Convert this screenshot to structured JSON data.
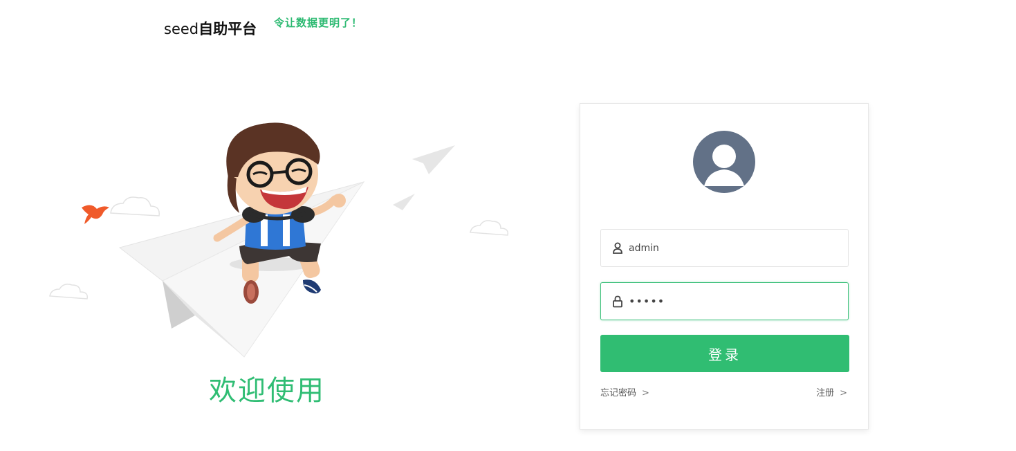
{
  "header": {
    "brand_prefix": "seed",
    "brand_suffix": "自助平台",
    "slogan": "令让数据更明了！"
  },
  "illustration": {
    "welcome_text": "欢迎使用"
  },
  "login": {
    "username_value": "admin",
    "password_value": "•••••",
    "submit_label": "登录",
    "forgot_label": "忘记密码",
    "register_label": "注册",
    "arrow": ">"
  },
  "colors": {
    "accent": "#30bd72",
    "avatar_bg": "#627187"
  },
  "icons": [
    "user-icon",
    "lock-icon",
    "avatar-icon"
  ]
}
